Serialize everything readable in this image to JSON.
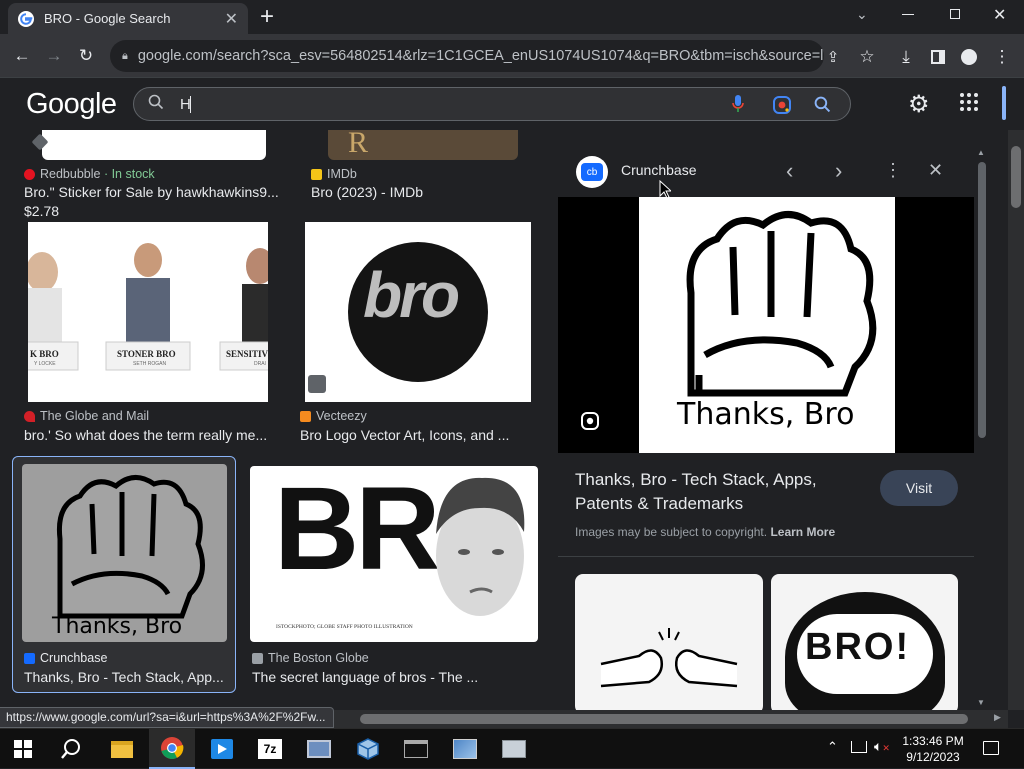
{
  "browser": {
    "tab_title": "BRO - Google Search",
    "new_tab": "+",
    "url": "google.com/search?sca_esv=564802514&rlz=1C1GCEA_enUS1074US1074&q=BRO&tbm=isch&source=ln...",
    "status_url": "https://www.google.com/url?sa=i&url=https%3A%2F%2Fw..."
  },
  "google": {
    "logo": "Google",
    "search_value": "H"
  },
  "results": [
    {
      "source": "Redbubble",
      "badge": "· In stock",
      "title": "Bro.\" Sticker for Sale by hawkhawkins9...",
      "price": "$2.78"
    },
    {
      "source": "IMDb",
      "title": "Bro (2023) - IMDb"
    },
    {
      "source": "The Globe and Mail",
      "title": "bro.' So what does the term really me...",
      "img_labels": [
        "K BRO",
        "STONER BRO",
        "SENSITIV"
      ],
      "img_sublabels": [
        "Y LOCKE",
        "SETH ROGAN",
        "DRAI"
      ]
    },
    {
      "source": "Vecteezy",
      "title": "Bro Logo Vector Art, Icons, and ...",
      "logo_text": "bro"
    },
    {
      "source": "Crunchbase",
      "title": "Thanks, Bro - Tech Stack, App...",
      "img_text": "Thanks, Bro"
    },
    {
      "source": "The Boston Globe",
      "title": "The secret language of bros - The ...",
      "img_text": "BR",
      "img_caption": "ISTOCKPHOTO; GLOBE STAFF PHOTO ILLUSTRATION"
    }
  ],
  "panel": {
    "source": "Crunchbase",
    "source_badge": "cb",
    "image_text": "Thanks, Bro",
    "title": "Thanks, Bro - Tech Stack, Apps, Patents & Trademarks",
    "visit": "Visit",
    "copyright": "Images may be subject to copyright.",
    "learn_more": "Learn More",
    "related_text": "BRO!"
  },
  "taskbar": {
    "time": "1:33:46 PM",
    "date": "9/12/2023",
    "app_7z": "7z"
  },
  "colors": {
    "accent": "#8ab4f8",
    "in_stock": "#81c995",
    "selected_border": "#8ab4f8"
  }
}
